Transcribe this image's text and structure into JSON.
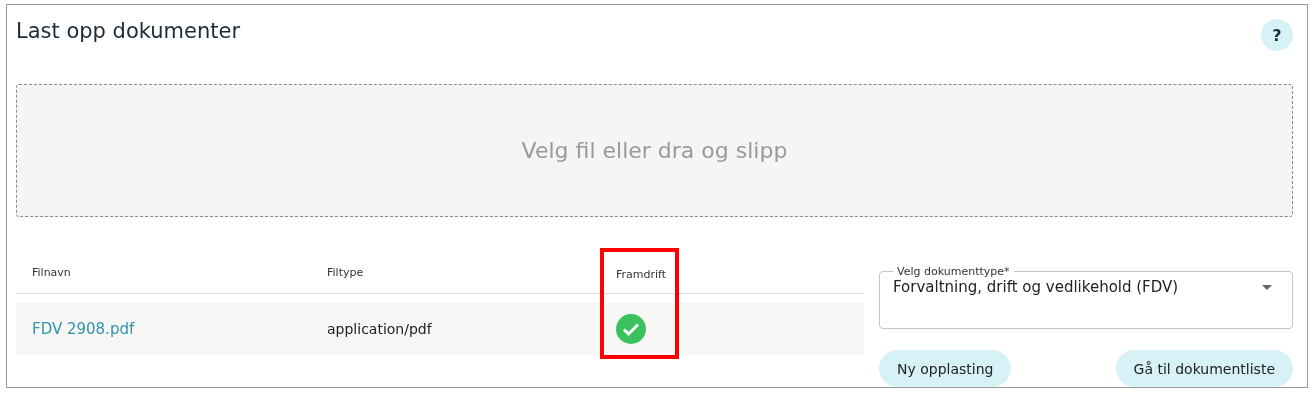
{
  "title": "Last opp dokumenter",
  "help_button": {
    "label": "?"
  },
  "drop_zone": {
    "label": "Velg fil eller dra og slipp"
  },
  "table": {
    "columns": [
      {
        "label": "Filnavn",
        "highlighted": false
      },
      {
        "label": "Filtype",
        "highlighted": false
      },
      {
        "label": "Framdrift",
        "highlighted": true
      }
    ],
    "rows": [
      {
        "filename": "FDV 2908.pdf",
        "filetype": "application/pdf",
        "done": true
      }
    ]
  },
  "document_type": {
    "label": "Velg dokumenttype*",
    "value": "Forvaltning, drift og vedlikehold (FDV)"
  },
  "buttons": [
    {
      "label": "Ny opplasting"
    },
    {
      "label": "Gå til dokumentliste"
    }
  ]
}
